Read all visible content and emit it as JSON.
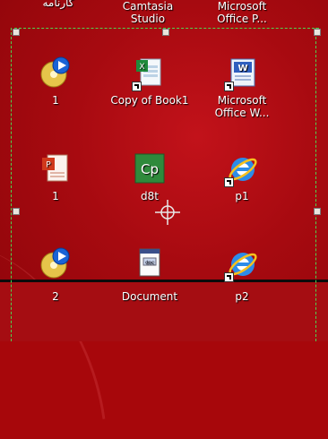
{
  "top_row": [
    {
      "line1": "کارنامه",
      "line2": ""
    },
    {
      "line1": "Camtasia",
      "line2": "Studio"
    },
    {
      "line1": "Microsoft",
      "line2": "Office P..."
    }
  ],
  "rows": [
    [
      {
        "label": "1",
        "icon": "media-disc-icon"
      },
      {
        "label": "Copy of Book1",
        "icon": "excel-file-icon"
      },
      {
        "label": "Microsoft Office W...",
        "icon": "word-document-icon"
      }
    ],
    [
      {
        "label": "1",
        "icon": "powerpoint-file-icon"
      },
      {
        "label": "d8t",
        "icon": "captivate-icon",
        "icon_text": "Cp"
      },
      {
        "label": "p1",
        "icon": "internet-explorer-icon"
      }
    ],
    [
      {
        "label": "2",
        "icon": "media-disc-icon"
      },
      {
        "label": "Document",
        "icon": "document-file-icon"
      },
      {
        "label": "p2",
        "icon": "internet-explorer-icon"
      }
    ]
  ],
  "colors": {
    "desktop_bg": "#a7070b",
    "selection": "#4fd44f"
  }
}
